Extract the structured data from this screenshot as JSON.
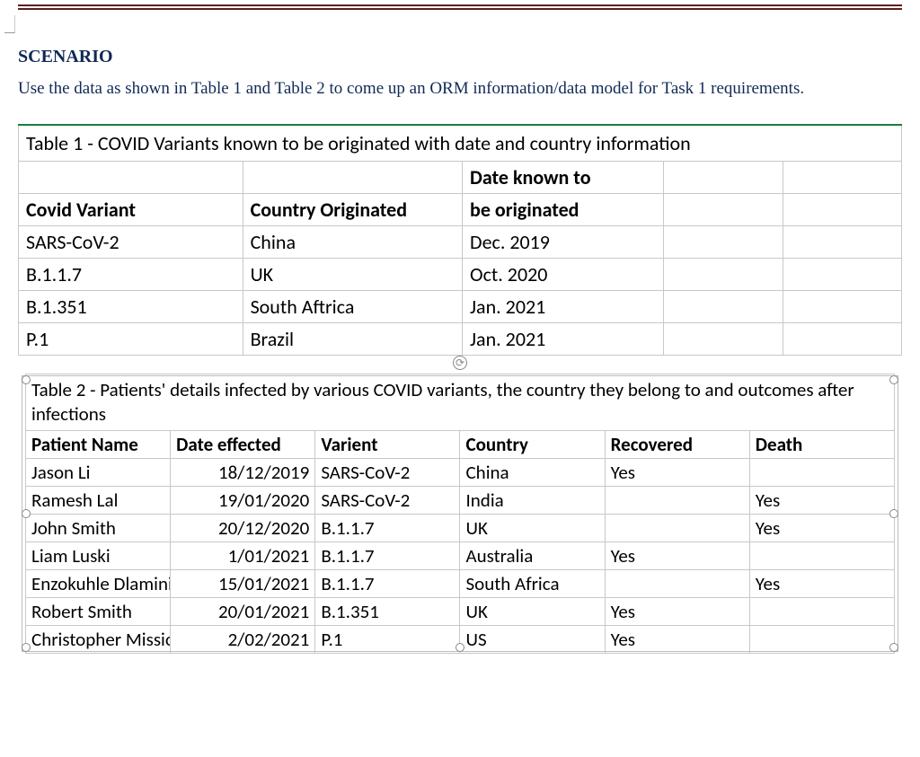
{
  "heading": "SCENARIO",
  "intro": "Use the data as shown in Table 1 and Table 2 to come up an ORM information/data model for Task 1 requirements.",
  "table1": {
    "title": "Table 1 - COVID Variants known to be originated with date and country information",
    "headers": {
      "variant": "Covid Variant",
      "country": "Country Originated",
      "date_line1": "Date known to",
      "date_line2": "be originated"
    },
    "rows": [
      {
        "variant": "SARS-CoV-2",
        "country": "China",
        "date": "Dec. 2019"
      },
      {
        "variant": "B.1.1.7",
        "country": "UK",
        "date": "Oct. 2020"
      },
      {
        "variant": "B.1.351",
        "country": "South Aftrica",
        "date": "Jan. 2021"
      },
      {
        "variant": "P.1",
        "country": "Brazil",
        "date": "Jan. 2021"
      }
    ]
  },
  "table2": {
    "title": "Table 2 - Patients' details  infected by various COVID variants, the country they belong to and outcomes after infections",
    "headers": {
      "name": "Patient Name",
      "date": "Date effected",
      "variant": "Varient",
      "country": "Country",
      "recovered": "Recovered",
      "death": "Death"
    },
    "rows": [
      {
        "name": "Jason Li",
        "date": "18/12/2019",
        "variant": "SARS-CoV-2",
        "country": "China",
        "recovered": "Yes",
        "death": ""
      },
      {
        "name": "Ramesh Lal",
        "date": "19/01/2020",
        "variant": "SARS-CoV-2",
        "country": "India",
        "recovered": "",
        "death": "Yes"
      },
      {
        "name": "John Smith",
        "date": "20/12/2020",
        "variant": "B.1.1.7",
        "country": "UK",
        "recovered": "",
        "death": "Yes"
      },
      {
        "name": "Liam Luski",
        "date": "1/01/2021",
        "variant": "B.1.1.7",
        "country": "Australia",
        "recovered": "Yes",
        "death": ""
      },
      {
        "name": "Enzokuhle Dlamini",
        "date": "15/01/2021",
        "variant": "B.1.1.7",
        "country": "South Africa",
        "recovered": "",
        "death": "Yes"
      },
      {
        "name": "Robert Smith",
        "date": "20/01/2021",
        "variant": "B.1.351",
        "country": "UK",
        "recovered": "Yes",
        "death": ""
      },
      {
        "name": "Christopher Mission",
        "date": "2/02/2021",
        "variant": "P.1",
        "country": "US",
        "recovered": "Yes",
        "death": ""
      }
    ]
  }
}
